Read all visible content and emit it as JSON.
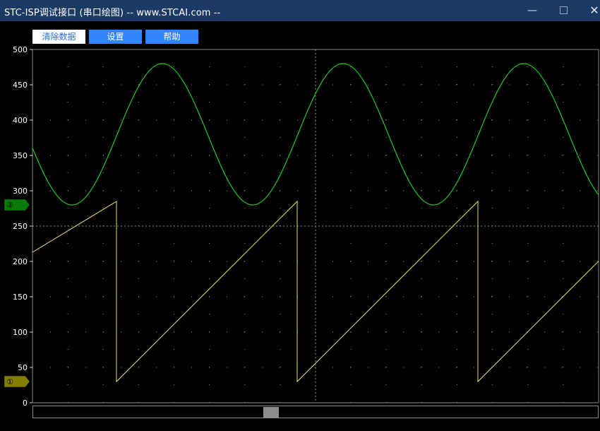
{
  "window": {
    "title": "STC-ISP调试接口 (串口绘图) -- www.STCAI.com --",
    "minimize_glyph": "—",
    "close_glyph": "✕"
  },
  "toolbar": {
    "clear_label": "清除数据",
    "settings_label": "设置",
    "help_label": "帮助"
  },
  "colors": {
    "title_bar": "#1b3a66",
    "button_blue": "#2f86ff",
    "grid_dots": "#8f8f8f",
    "channel_1": "#f2e07a",
    "channel_2": "#1fc81f",
    "marker_1": "#7f7f00",
    "marker_2": "#0a7a0a"
  },
  "chart_data": {
    "type": "line",
    "y_ticks": [
      0,
      50,
      100,
      150,
      200,
      250,
      300,
      350,
      400,
      450,
      500
    ],
    "ylim": [
      0,
      500
    ],
    "grid": true,
    "channel_markers": [
      {
        "label": "①",
        "value": 30,
        "color": "#7f7f00"
      },
      {
        "label": "②",
        "value": 280,
        "color": "#0a7a0a"
      }
    ],
    "series": [
      {
        "kind": "sine",
        "color": "#1fc81f",
        "min": 280,
        "max": 480,
        "period_px": 256,
        "first_min_px": 56
      },
      {
        "kind": "sawtooth",
        "color": "#f2e07a",
        "min": 30,
        "max": 285,
        "period_px": 256,
        "first_peak_px": 119,
        "start_value": 213
      }
    ]
  }
}
